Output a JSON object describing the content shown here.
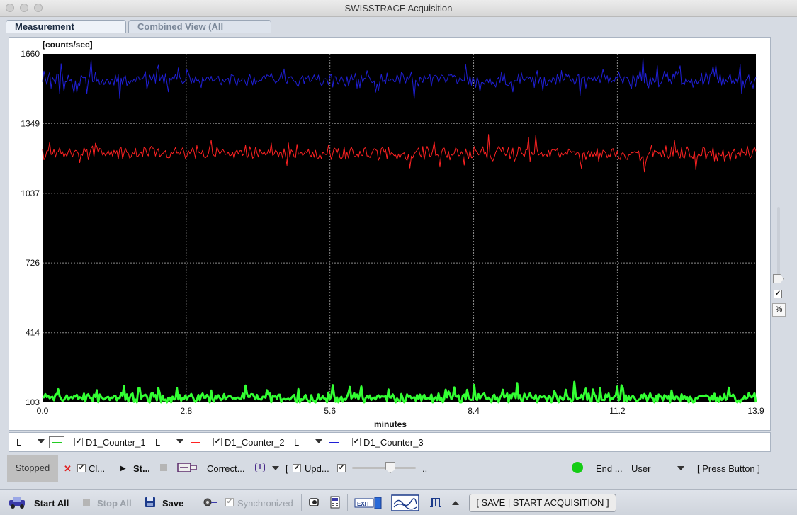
{
  "window": {
    "title": "SWISSTRACE Acquisition"
  },
  "tabs": [
    {
      "label": "Measurement Device(s)",
      "active": true
    },
    {
      "label": "Combined View (All devices)",
      "active": false
    }
  ],
  "chart_data": {
    "type": "line",
    "ylabel": "[counts/sec]",
    "xlabel": "minutes",
    "ylim": [
      103,
      1660
    ],
    "xlim": [
      0.0,
      13.9
    ],
    "y_ticks": [
      "103",
      "414",
      "726",
      "1037",
      "1349",
      "1660"
    ],
    "x_ticks": [
      "0.0",
      "2.8",
      "5.6",
      "8.4",
      "11.2",
      "13.9"
    ],
    "background": "#000000",
    "grid": true,
    "series": [
      {
        "name": "D1_Counter_1",
        "color": "#33ff33",
        "mean": 125,
        "noise": 14,
        "spike_rate": 0.12,
        "spike_amp": 45,
        "stroke_width": 3
      },
      {
        "name": "D1_Counter_2",
        "color": "#ff2222",
        "mean": 1215,
        "noise": 22,
        "spike_rate": 0.08,
        "spike_amp": 55,
        "stroke_width": 1
      },
      {
        "name": "D1_Counter_3",
        "color": "#1f1fd6",
        "mean": 1545,
        "noise": 24,
        "spike_rate": 0.08,
        "spike_amp": 60,
        "stroke_width": 1
      }
    ],
    "n_points": 500
  },
  "legend": {
    "items": [
      {
        "axis": "L",
        "label": "D1_Counter_1",
        "color": "#22cc22",
        "checked": true
      },
      {
        "axis": "L",
        "label": "D1_Counter_2",
        "color": "#ff2222",
        "checked": true
      },
      {
        "axis": "L",
        "label": "D1_Counter_3",
        "color": "#1f1fd6",
        "checked": true
      }
    ]
  },
  "controls": {
    "status": "Stopped",
    "clear_label": "Cl...",
    "start_label": "St...",
    "correct_label": "Correct...",
    "correct_icon_label": "I",
    "update_bracket": "[",
    "update_label": "Upd...",
    "slider_value_label": "..",
    "slider_fraction": 0.6,
    "end_label": "End ...",
    "user_label": "User",
    "press_button_label": "[ Press Button ]",
    "indicator_color": "#14cc14"
  },
  "side": {
    "percent_label": "%"
  },
  "toolbar": {
    "start_all": "Start All",
    "stop_all": "Stop All",
    "save": "Save",
    "synchronized": "Synchronized",
    "save_start": "[ SAVE | START ACQUISITION ]"
  }
}
